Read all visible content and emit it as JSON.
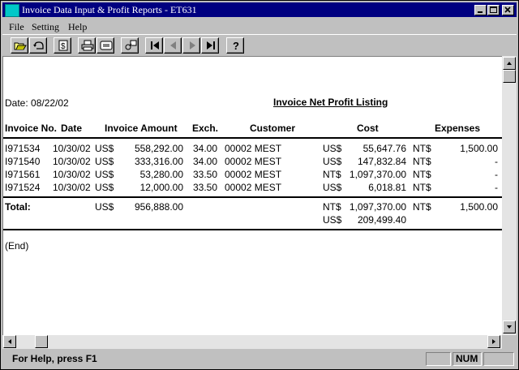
{
  "window": {
    "title": "Invoice Data Input & Profit Reports - ET631"
  },
  "menu": {
    "file": "File",
    "setting": "Setting",
    "help": "Help"
  },
  "report": {
    "date": "Date: 08/22/02",
    "title": "Invoice Net Profit Listing",
    "columns": [
      "Invoice No.",
      "Date",
      "Invoice Amount",
      "Exch.",
      "Customer",
      "Cost",
      "Expenses"
    ],
    "rows": [
      {
        "invoice": "I971534",
        "date": "10/30/02",
        "amt_cur": "US$",
        "amount": "558,292.00",
        "exch": "34.00",
        "customer": "00002 MEST",
        "cost_cur": "US$",
        "cost": "55,647.76",
        "exp_cur": "NT$",
        "expenses": "1,500.00"
      },
      {
        "invoice": "I971540",
        "date": "10/30/02",
        "amt_cur": "US$",
        "amount": "333,316.00",
        "exch": "34.00",
        "customer": "00002 MEST",
        "cost_cur": "US$",
        "cost": "147,832.84",
        "exp_cur": "NT$",
        "expenses": "-"
      },
      {
        "invoice": "I971561",
        "date": "10/30/02",
        "amt_cur": "US$",
        "amount": "53,280.00",
        "exch": "33.50",
        "customer": "00002 MEST",
        "cost_cur": "NT$",
        "cost": "1,097,370.00",
        "exp_cur": "NT$",
        "expenses": "-"
      },
      {
        "invoice": "I971524",
        "date": "10/30/02",
        "amt_cur": "US$",
        "amount": "12,000.00",
        "exch": "33.50",
        "customer": "00002 MEST",
        "cost_cur": "US$",
        "cost": "6,018.81",
        "exp_cur": "NT$",
        "expenses": "-"
      }
    ],
    "total": {
      "label": "Total:",
      "amt_cur": "US$",
      "amount": "956,888.00",
      "cost_cur_1": "NT$",
      "cost_1": "1,097,370.00",
      "exp_cur": "NT$",
      "expenses": "1,500.00",
      "cost_cur_2": "US$",
      "cost_2": "209,499.40"
    },
    "end": "(End)"
  },
  "status": {
    "help_text": "For Help, press F1",
    "num": "NUM"
  }
}
